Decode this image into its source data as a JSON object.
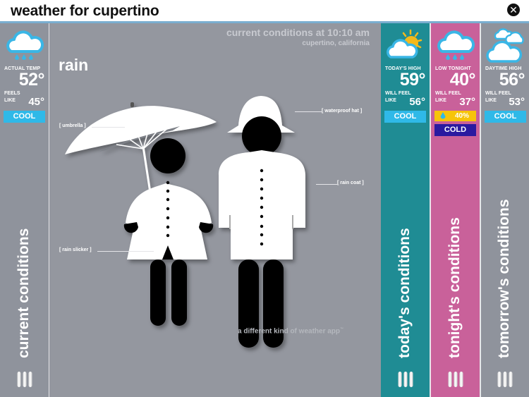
{
  "app": {
    "title": "weather for cupertino",
    "close_icon": "close-circle-icon"
  },
  "current": {
    "icon": "rain-cloud-icon",
    "temp_label": "ACTUAL TEMP",
    "temp": "52°",
    "feels_label_1": "FEELS",
    "feels_label_2": "LIKE",
    "feels": "45°",
    "badge": "COOL",
    "tab_label": "current conditions",
    "colors": {
      "panel": "#8f939c",
      "badge": "#2fb9e8"
    }
  },
  "main": {
    "header": "current conditions at 10:10 am",
    "location": "cupertino, california",
    "condition": "rain",
    "annotations": {
      "umbrella": "[ umbrella ]",
      "waterproof_hat": "[ waterproof hat ]",
      "rain_coat": "[ rain coat ]",
      "rain_slicker": "[ rain slicker ]"
    },
    "tagline": "a different kind of weather app",
    "tagline_mark": "™"
  },
  "today": {
    "icon": "partly-sunny-cloud-icon",
    "temp_label": "TODAY'S HIGH",
    "temp": "59°",
    "feels_label_1": "WILL FEEL",
    "feels_label_2": "LIKE",
    "feels": "56°",
    "badge": "COOL",
    "tab_label": "today's conditions",
    "colors": {
      "panel": "#1f8c94"
    }
  },
  "tonight": {
    "icon": "rain-cloud-icon",
    "temp_label": "LOW TONIGHT",
    "temp": "40°",
    "feels_label_1": "WILL FEEL",
    "feels_label_2": "LIKE",
    "feels": "37°",
    "precip_icon": "raindrop-icon",
    "precip": "40%",
    "badge": "COLD",
    "tab_label": "tonight's conditions",
    "colors": {
      "panel": "#c9619a",
      "precip": "#f7c40a",
      "badge": "#2a1aa0"
    }
  },
  "tomorrow": {
    "icon": "cloudy-icon",
    "temp_label": "DAYTIME HIGH",
    "temp": "56°",
    "feels_label_1": "WILL FEEL",
    "feels_label_2": "LIKE",
    "feels": "53°",
    "badge": "COOL",
    "tab_label": "tomorrow's conditions",
    "colors": {
      "panel": "#8f939c"
    }
  }
}
